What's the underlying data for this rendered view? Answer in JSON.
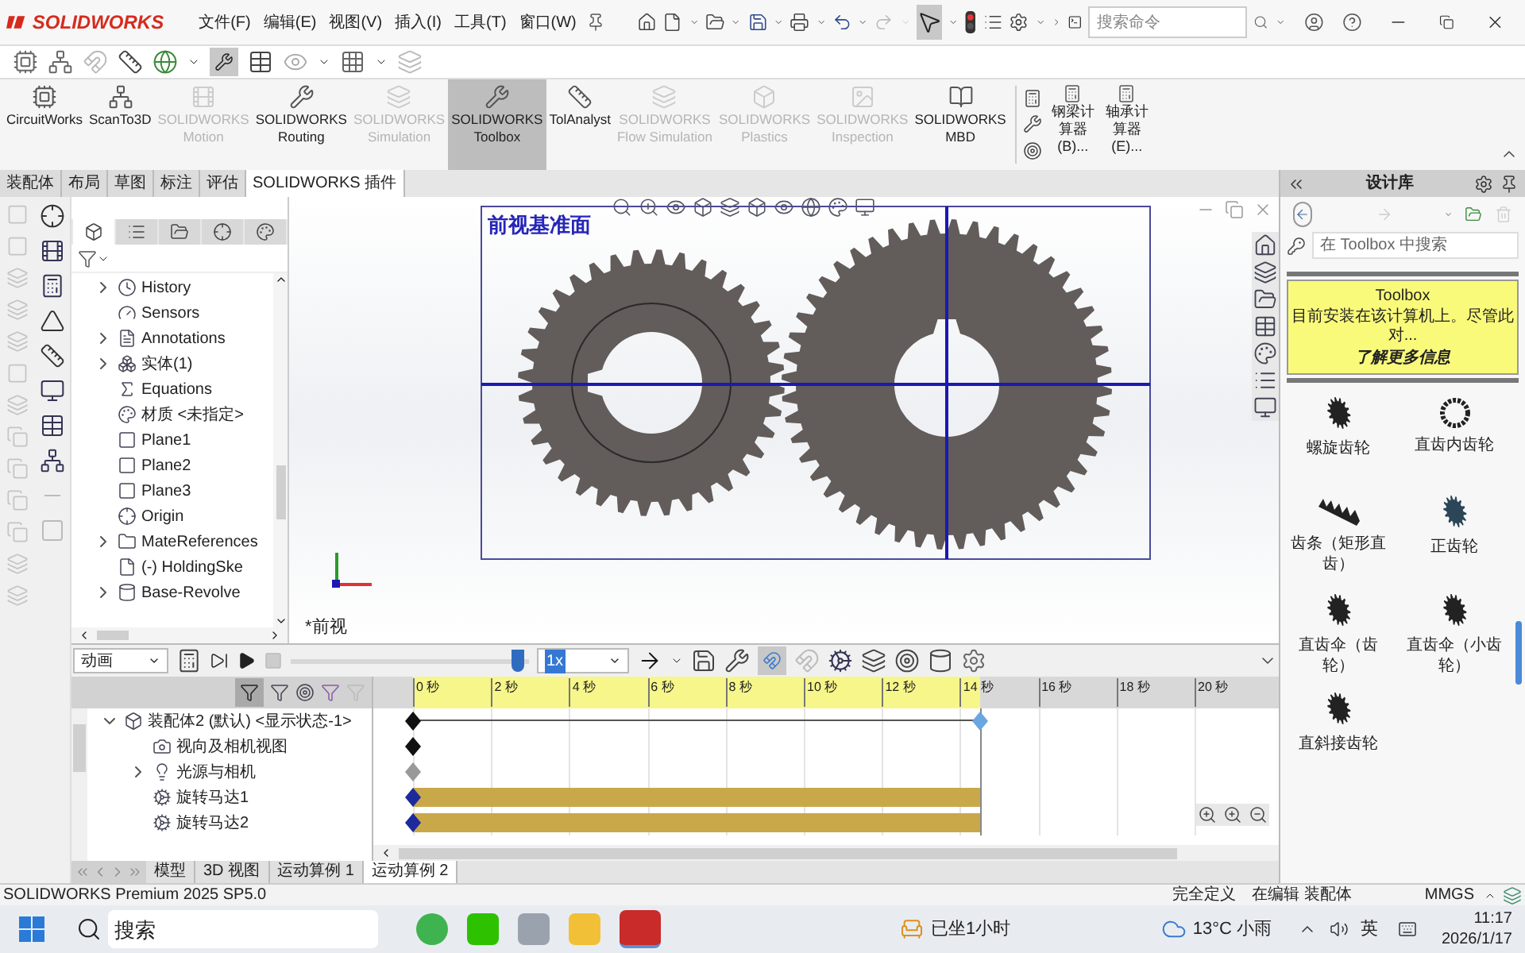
{
  "app": {
    "logo": "SOLIDWORKS",
    "menus": [
      "文件(F)",
      "编辑(E)",
      "视图(V)",
      "插入(I)",
      "工具(T)",
      "窗口(W)"
    ]
  },
  "search": {
    "placeholder": "搜索命令"
  },
  "command_buttons": [
    {
      "label": "CircuitWorks",
      "disabled": false,
      "selected": false
    },
    {
      "label": "ScanTo3D",
      "disabled": false,
      "selected": false
    },
    {
      "label": "SOLIDWORKS\nMotion",
      "disabled": true,
      "selected": false
    },
    {
      "label": "SOLIDWORKS\nRouting",
      "disabled": false,
      "selected": false
    },
    {
      "label": "SOLIDWORKS\nSimulation",
      "disabled": true,
      "selected": false
    },
    {
      "label": "SOLIDWORKS\nToolbox",
      "disabled": false,
      "selected": true
    },
    {
      "label": "TolAnalyst",
      "disabled": false,
      "selected": false
    },
    {
      "label": "SOLIDWORKS\nFlow Simulation",
      "disabled": true,
      "selected": false
    },
    {
      "label": "SOLIDWORKS\nPlastics",
      "disabled": true,
      "selected": false
    },
    {
      "label": "SOLIDWORKS\nInspection",
      "disabled": true,
      "selected": false
    },
    {
      "label": "SOLIDWORKS\nMBD",
      "disabled": false,
      "selected": false
    }
  ],
  "calculators": [
    "钢梁计算器(B)...",
    "轴承计算器(E)..."
  ],
  "tabs": [
    {
      "label": "装配体",
      "selected": false
    },
    {
      "label": "布局",
      "selected": false
    },
    {
      "label": "草图",
      "selected": false
    },
    {
      "label": "标注",
      "selected": false
    },
    {
      "label": "评估",
      "selected": false
    },
    {
      "label": "SOLIDWORKS 插件",
      "selected": true
    }
  ],
  "panel_tabs": [
    {
      "selected": true
    },
    {
      "selected": false
    },
    {
      "selected": false
    },
    {
      "selected": false
    },
    {
      "selected": false
    }
  ],
  "feature_tree": [
    {
      "label": "History",
      "expandable": true,
      "kind": "history"
    },
    {
      "label": "Sensors",
      "expandable": false,
      "kind": "sensors"
    },
    {
      "label": "Annotations",
      "expandable": true,
      "kind": "annotations"
    },
    {
      "label": "实体(1)",
      "expandable": true,
      "kind": "solid"
    },
    {
      "label": "Equations",
      "expandable": false,
      "kind": "equations"
    },
    {
      "label": "材质 <未指定>",
      "expandable": false,
      "kind": "material"
    },
    {
      "label": "Plane1",
      "expandable": false,
      "kind": "plane"
    },
    {
      "label": "Plane2",
      "expandable": false,
      "kind": "plane"
    },
    {
      "label": "Plane3",
      "expandable": false,
      "kind": "plane"
    },
    {
      "label": "Origin",
      "expandable": false,
      "kind": "origin"
    },
    {
      "label": "MateReferences",
      "expandable": true,
      "kind": "references"
    },
    {
      "label": "(-) HoldingSke",
      "expandable": false,
      "kind": "sketch"
    },
    {
      "label": "Base-Revolve",
      "expandable": true,
      "kind": "revolve"
    }
  ],
  "graphics": {
    "view_label": "前视基准面",
    "orientation_label": "*前视"
  },
  "design_library": {
    "title": "设计库",
    "search_placeholder": "在 Toolbox 中搜索",
    "notice": {
      "title": "Toolbox",
      "text": "目前安装在该计算机上。尽管此对...",
      "link": "了解更多信息"
    },
    "items": [
      {
        "label": "螺旋齿轮",
        "kind": "helical"
      },
      {
        "label": "直齿内齿轮",
        "kind": "ring"
      },
      {
        "label": "齿条（矩形直齿）",
        "kind": "rack"
      },
      {
        "label": "正齿轮",
        "kind": "spur"
      },
      {
        "label": "直齿伞（齿轮）",
        "kind": "bevel"
      },
      {
        "label": "直齿伞（小齿轮）",
        "kind": "bevel"
      },
      {
        "label": "直斜接齿轮",
        "kind": "miter"
      }
    ]
  },
  "motion_study": {
    "mode": "动画",
    "playback": {
      "level": 0.98
    },
    "speed": "1x",
    "ruler": [
      "0 秒",
      "2 秒",
      "4 秒",
      "6 秒",
      "8 秒",
      "10 秒",
      "12 秒",
      "14 秒",
      "16 秒",
      "18 秒",
      "20 秒"
    ],
    "tree": [
      {
        "label": "装配体2 (默认) <显示状态-1>",
        "expandable": true,
        "expanded": true,
        "kind": "assembly",
        "children": [
          {
            "label": "视向及相机视图",
            "expandable": false,
            "kind": "camera"
          },
          {
            "label": "光源与相机",
            "expandable": true,
            "expanded": false,
            "kind": "lights"
          },
          {
            "label": "旋转马达1",
            "expandable": false,
            "kind": "motor"
          },
          {
            "label": "旋转马达2",
            "expandable": false,
            "kind": "motor"
          }
        ]
      }
    ]
  },
  "bottom_tabs": [
    {
      "label": "模型",
      "selected": false
    },
    {
      "label": "3D 视图",
      "selected": false
    },
    {
      "label": "运动算例 1",
      "selected": false
    },
    {
      "label": "运动算例 2",
      "selected": true
    }
  ],
  "status_bar": {
    "product": "SOLIDWORKS Premium 2025 SP5.0",
    "items": [
      "完全定义",
      "在编辑 装配体",
      "MMGS"
    ]
  },
  "taskbar": {
    "search_placeholder": "搜索",
    "notification": "已坐1小时",
    "weather": "13°C 小雨",
    "ime": "英",
    "time": "11:17",
    "date": "2026/1/17"
  }
}
